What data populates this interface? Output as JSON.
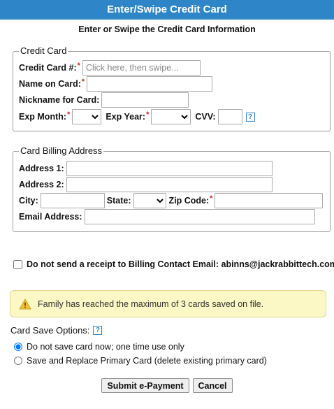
{
  "title": "Enter/Swipe Credit Card",
  "subtitle": "Enter or Swipe the Credit Card Information",
  "credit_card": {
    "legend": "Credit Card",
    "card_number_label": "Credit Card #:",
    "card_number_placeholder": "Click here, then swipe...",
    "name_label": "Name on Card:",
    "nickname_label": "Nickname for Card:",
    "exp_month_label": "Exp Month:",
    "exp_year_label": "Exp Year:",
    "cvv_label": "CVV:",
    "required_mark": "*",
    "help_glyph": "?"
  },
  "billing": {
    "legend": "Card Billing Address",
    "address1_label": "Address 1:",
    "address2_label": "Address 2:",
    "city_label": "City:",
    "state_label": "State:",
    "zip_label": "Zip Code:",
    "email_label": "Email Address:"
  },
  "receipt_checkbox_label": "Do not send a receipt to Billing Contact Email: abinns@jackrabbittech.com",
  "warning": {
    "icon": "warning-triangle-icon",
    "text": "Family has reached the maximum of 3 cards saved on file."
  },
  "save_options": {
    "title": "Card Save Options:",
    "options": [
      {
        "label": "Do not save card now; one time use only",
        "selected": true
      },
      {
        "label": "Save and Replace Primary Card (delete existing primary card)",
        "selected": false
      }
    ]
  },
  "buttons": {
    "submit": "Submit e-Payment",
    "cancel": "Cancel"
  },
  "colors": {
    "header": "#2e86c9",
    "required": "#d21f1f",
    "warning_bg": "#fcf8c5"
  }
}
